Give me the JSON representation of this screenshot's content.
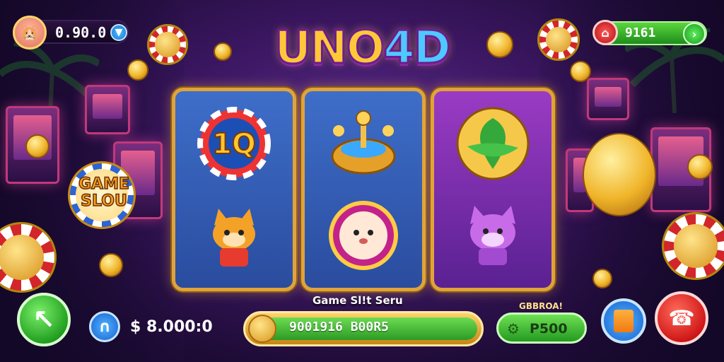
{
  "header": {
    "logo_text_1": "UNO",
    "logo_text_2": "4D",
    "balance": "0.90.0",
    "gems": "9161"
  },
  "side_sign": {
    "line1": "GAME",
    "line2": "SLOU"
  },
  "reels": [
    {
      "top_symbol": "10-chip-icon",
      "bottom_symbol": "orange-cat-icon"
    },
    {
      "top_symbol": "golden-joystick-icon",
      "bottom_symbol": "cat-roulette-icon"
    },
    {
      "top_symbol": "green-leaf-icon",
      "bottom_symbol": "purple-cat-icon"
    }
  ],
  "footer": {
    "caption": "Game Sl!t Seru",
    "bet": "$ 8.000:0",
    "spin_value": "9001916 B00R5",
    "auto_label": "GBBROA!",
    "win_value": "P500"
  },
  "colors": {
    "accent_gold": "#e0a33a",
    "bg_purple": "#3a1660",
    "green": "#2c9a24",
    "red": "#d01818",
    "blue": "#1a5fd0"
  }
}
